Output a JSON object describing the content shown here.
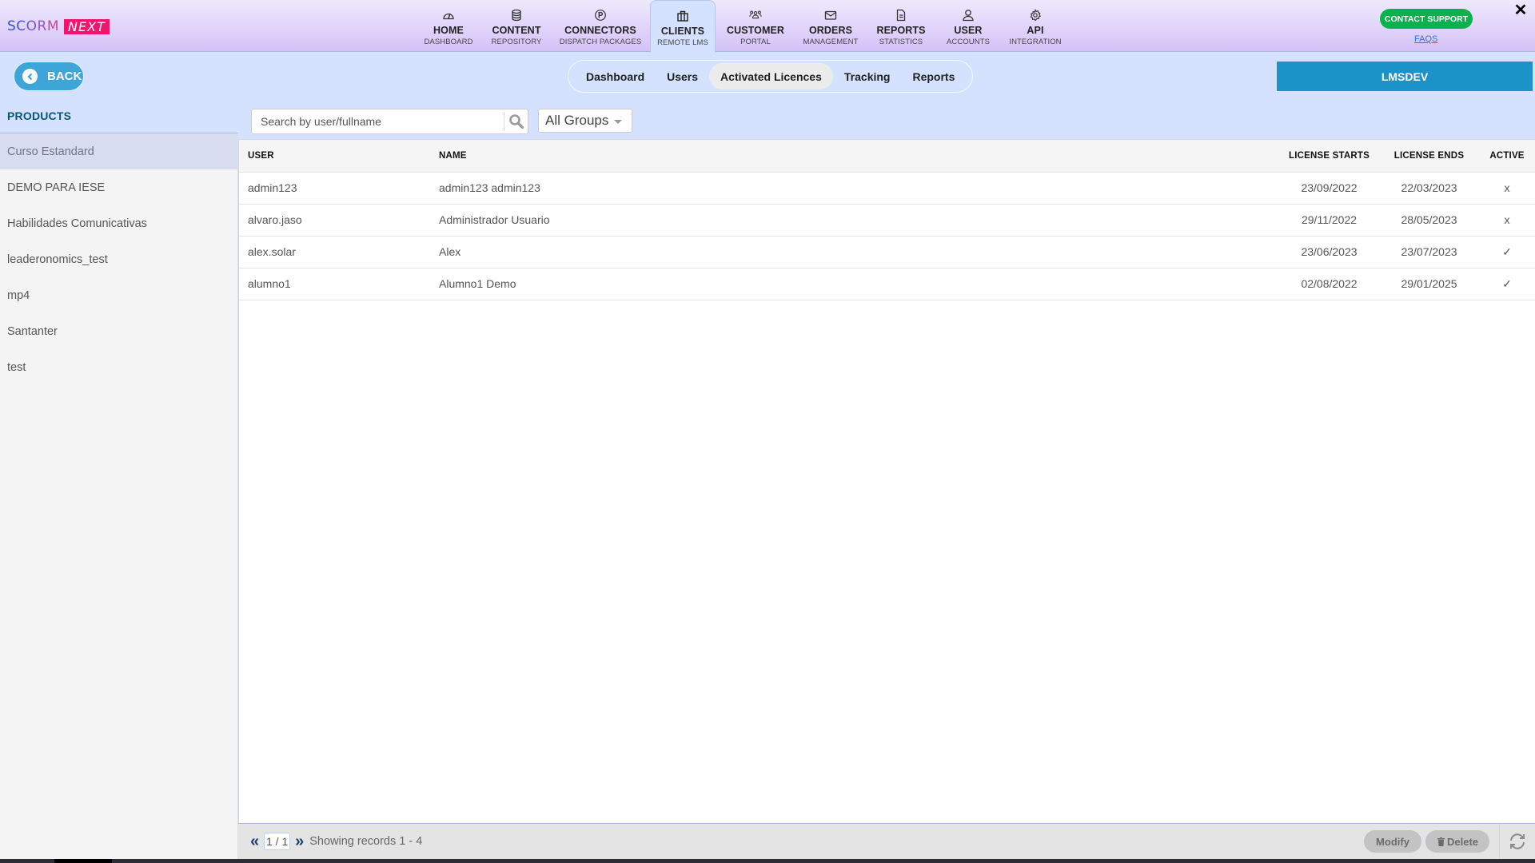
{
  "app": {
    "logo_primary": "SCORM",
    "logo_secondary": "NEXT",
    "brand_colors": {
      "accent": "#f0146e",
      "primary_blue": "#1b93c9",
      "success": "#0ab14c"
    }
  },
  "nav": {
    "items": [
      {
        "title": "HOME",
        "subtitle": "DASHBOARD",
        "icon": "gauge-icon",
        "active": false
      },
      {
        "title": "CONTENT",
        "subtitle": "REPOSITORY",
        "icon": "database-icon",
        "active": false
      },
      {
        "title": "CONNECTORS",
        "subtitle": "DISPATCH PACKAGES",
        "icon": "p-circle-icon",
        "active": false
      },
      {
        "title": "CLIENTS",
        "subtitle": "REMOTE LMS",
        "icon": "briefcase-icon",
        "active": true
      },
      {
        "title": "CUSTOMER",
        "subtitle": "PORTAL",
        "icon": "users-icon",
        "active": false
      },
      {
        "title": "ORDERS",
        "subtitle": "MANAGEMENT",
        "icon": "envelope-icon",
        "active": false
      },
      {
        "title": "REPORTS",
        "subtitle": "STATISTICS",
        "icon": "document-icon",
        "active": false
      },
      {
        "title": "USER",
        "subtitle": "ACCOUNTS",
        "icon": "user-icon",
        "active": false
      },
      {
        "title": "API",
        "subtitle": "INTEGRATION",
        "icon": "gear-icon",
        "active": false
      }
    ],
    "contact_support": "CONTACT SUPPORT",
    "faqs": "FAQS",
    "close": "✕"
  },
  "back_button": "BACK",
  "subtabs": [
    {
      "label": "Dashboard",
      "active": false
    },
    {
      "label": "Users",
      "active": false
    },
    {
      "label": "Activated Licences",
      "active": true
    },
    {
      "label": "Tracking",
      "active": false
    },
    {
      "label": "Reports",
      "active": false
    }
  ],
  "client_name": "LMSDEV",
  "sidebar": {
    "title": "PRODUCTS",
    "items": [
      {
        "label": "Curso Estandard",
        "active": true
      },
      {
        "label": "DEMO PARA IESE",
        "active": false
      },
      {
        "label": "Habilidades Comunicativas",
        "active": false
      },
      {
        "label": "leaderonomics_test",
        "active": false
      },
      {
        "label": "mp4",
        "active": false
      },
      {
        "label": "Santanter",
        "active": false
      },
      {
        "label": "test",
        "active": false
      }
    ]
  },
  "toolbar": {
    "search_placeholder": "Search by user/fullname",
    "search_value": "",
    "group_filter": "All Groups"
  },
  "table": {
    "columns": [
      "USER",
      "NAME",
      "LICENSE STARTS",
      "LICENSE ENDS",
      "ACTIVE"
    ],
    "rows": [
      {
        "user": "admin123",
        "name": "admin123 admin123",
        "starts": "23/09/2022",
        "ends": "22/03/2023",
        "active": "x"
      },
      {
        "user": "alvaro.jaso",
        "name": "Administrador Usuario",
        "starts": "29/11/2022",
        "ends": "28/05/2023",
        "active": "x"
      },
      {
        "user": "alex.solar",
        "name": "Alex",
        "starts": "23/06/2023",
        "ends": "23/07/2023",
        "active": "✓"
      },
      {
        "user": "alumno1",
        "name": "Alumno1 Demo",
        "starts": "02/08/2022",
        "ends": "29/01/2025",
        "active": "✓"
      }
    ]
  },
  "footer": {
    "first": "«",
    "last": "»",
    "page": "1 / 1",
    "records": "Showing records 1 - 4",
    "modify": "Modify",
    "delete": "Delete"
  }
}
